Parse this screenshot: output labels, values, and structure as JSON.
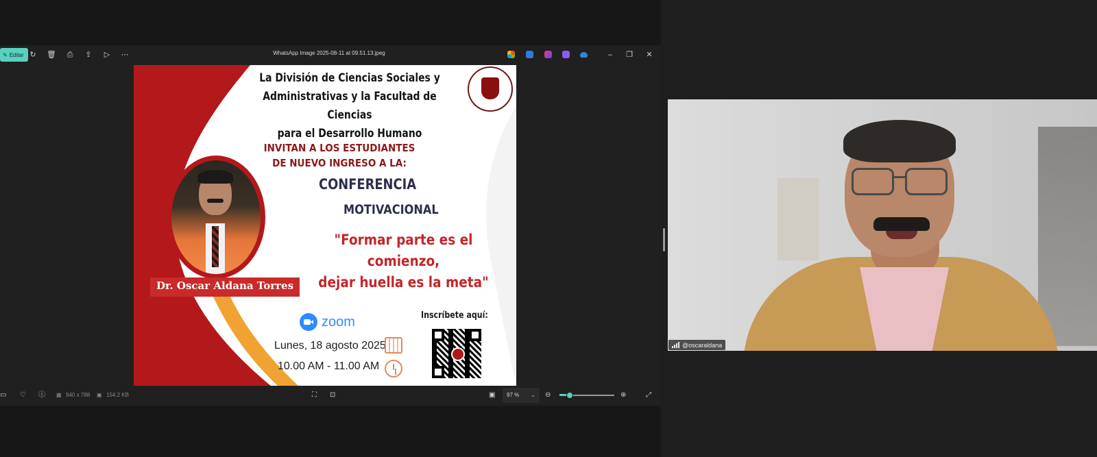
{
  "toolbar": {
    "edit_label": "Editar",
    "icons": [
      "rotate-icon",
      "delete-icon",
      "print-icon",
      "share-icon",
      "slideshow-icon",
      "more-icon"
    ],
    "file_title": "WhatsApp Image 2025-08-11 at 09.51.13.jpeg",
    "window_controls": {
      "minimize": "–",
      "restore": "❐",
      "close": "✕"
    }
  },
  "poster": {
    "heading": [
      "La División de Ciencias Sociales y",
      "Administrativas  y la  Facultad de Ciencias",
      "para el Desarrollo Humano"
    ],
    "invite": [
      "INVITAN A LOS ESTUDIANTES",
      "DE NUEVO INGRESO A LA:"
    ],
    "conference_1": "CONFERENCIA",
    "conference_2": "MOTIVACIONAL",
    "quote": [
      "\"Formar parte es el comienzo,",
      "dejar huella es la meta\""
    ],
    "speaker": "Dr. Oscar Aldana Torres",
    "zoom_word": "zoom",
    "date": "Lunes, 18 agosto 2025",
    "time": "10.00 AM - 11.00 AM",
    "register": "Inscríbete aquí:"
  },
  "status_bar": {
    "dimensions": "940 x 788",
    "file_size": "154.2 KB",
    "zoom_level": "97 %",
    "zoom_fraction": 0.15
  },
  "video": {
    "participant": "@oscaraldana"
  },
  "colors": {
    "accent": "#5ad0c0",
    "poster_red": "#b3181b",
    "poster_orange": "#f0a233",
    "zoom_blue": "#2d8cff"
  }
}
